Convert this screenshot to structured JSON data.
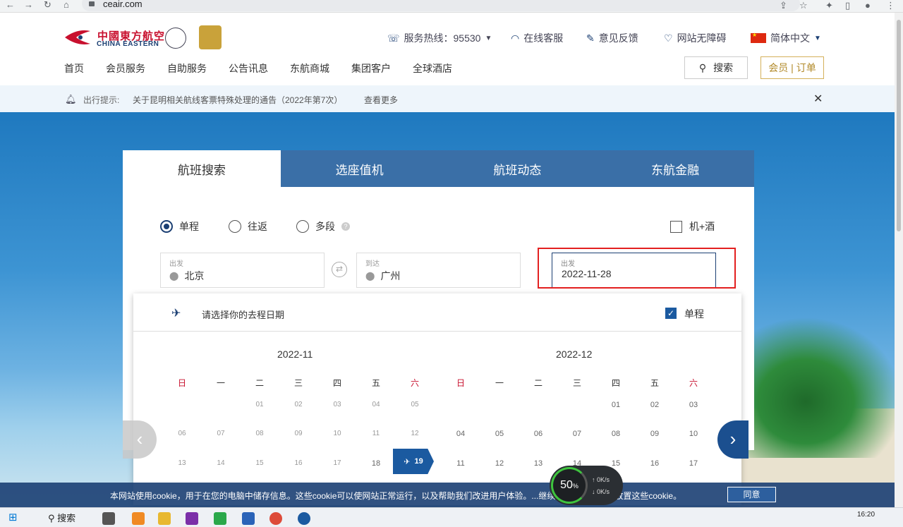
{
  "browser": {
    "url": "ceair.com"
  },
  "logo": {
    "cn": "中國東方航空",
    "en": "CHINA EASTERN"
  },
  "header": {
    "hotline": "服务热线：95530",
    "service": "在线客服",
    "feedback": "意见反馈",
    "accessibility": "网站无障碍",
    "language": "简体中文"
  },
  "nav": [
    "首页",
    "会员服务",
    "自助服务",
    "公告讯息",
    "东航商城",
    "集团客户",
    "全球酒店"
  ],
  "search_label": "搜索",
  "member_label": "会员 | 订单",
  "notice": {
    "prefix": "出行提示:",
    "text": "关于昆明相关航线客票特殊处理的通告（2022年第7次）",
    "more": "查看更多"
  },
  "tabs": [
    "航班搜索",
    "选座值机",
    "航班动态",
    "东航金融"
  ],
  "trip": {
    "oneway": "单程",
    "round": "往返",
    "multi": "多段",
    "hotel": "机+酒"
  },
  "from": {
    "label": "出发",
    "value": "北京"
  },
  "to": {
    "label": "到达",
    "value": "广州"
  },
  "date": {
    "label": "出发",
    "value": "2022-11-28"
  },
  "calendar": {
    "header": "请选择你的去程日期",
    "oneway": "单程",
    "months": [
      "2022-11",
      "2022-12"
    ],
    "dow": [
      "日",
      "一",
      "二",
      "三",
      "四",
      "五",
      "六"
    ],
    "nov_rows": [
      [
        "",
        "",
        "01",
        "02",
        "03",
        "04",
        "05"
      ],
      [
        "06",
        "07",
        "08",
        "09",
        "10",
        "11",
        "12"
      ],
      [
        "13",
        "14",
        "15",
        "16",
        "17",
        "18",
        "19"
      ]
    ],
    "dec_rows": [
      [
        "",
        "",
        "",
        "",
        "01",
        "02",
        "03"
      ],
      [
        "04",
        "05",
        "06",
        "07",
        "08",
        "09",
        "10"
      ],
      [
        "11",
        "12",
        "13",
        "14",
        "15",
        "16",
        "17"
      ]
    ],
    "selected": "19"
  },
  "cookie": {
    "text": "本网站使用cookie，用于在您的电脑中储存信息。这些cookie可以使网站正常运行，以及帮助我们改进用户体验。...继续浏览表示您接受放置这些cookie。",
    "agree": "同意"
  },
  "speed": {
    "value": "50",
    "unit": "%",
    "up": "0K/s",
    "down": "0K/s"
  },
  "taskbar": {
    "search": "搜索",
    "time": "16:20"
  }
}
